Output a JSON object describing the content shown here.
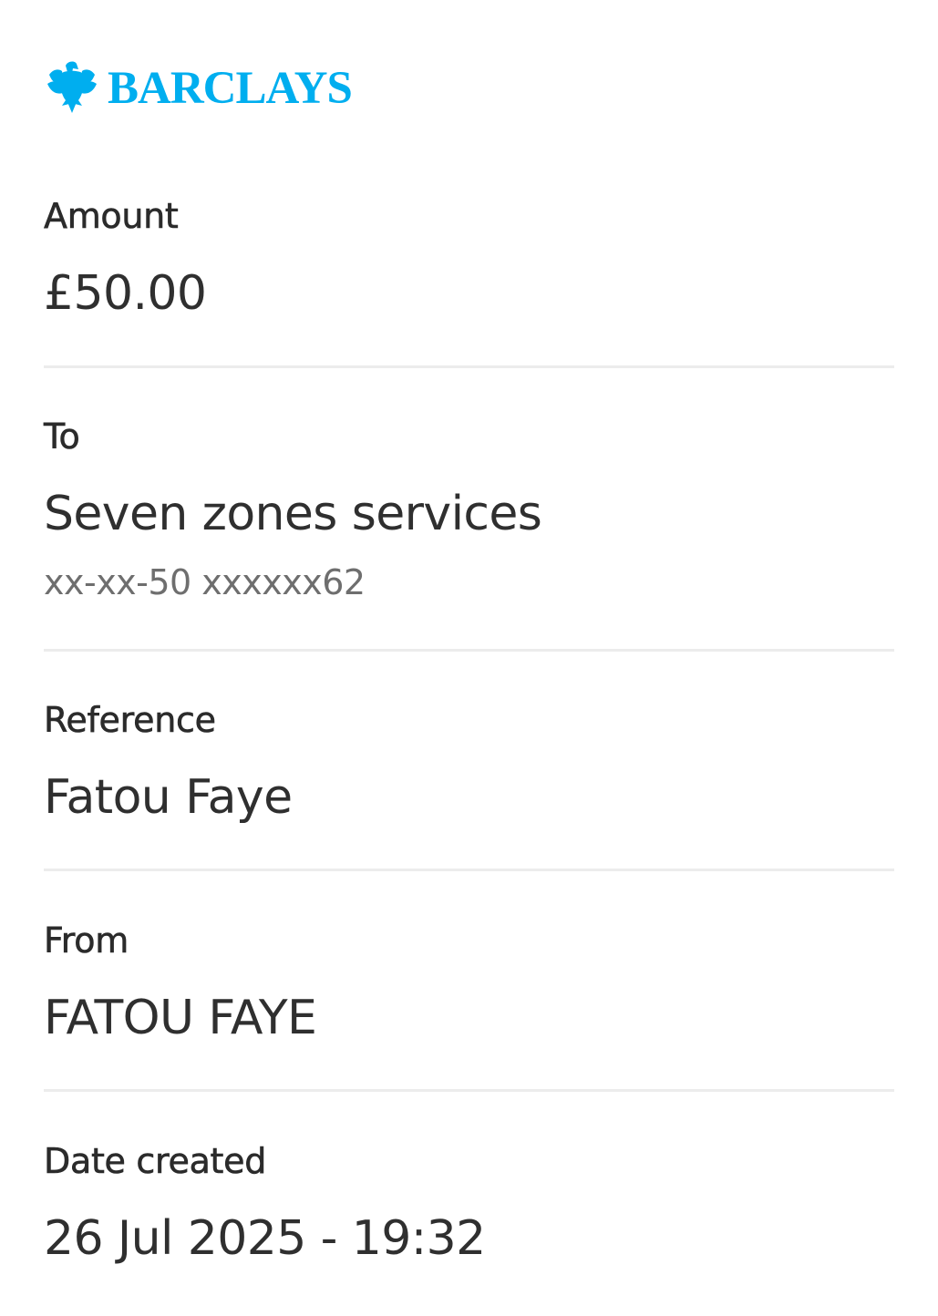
{
  "brand": {
    "name": "BARCLAYS",
    "color": "#00AEEF",
    "icon": "eagle-icon"
  },
  "fields": {
    "amount": {
      "label": "Amount",
      "value": "£50.00"
    },
    "to": {
      "label": "To",
      "value": "Seven zones services",
      "account": "xx-xx-50 xxxxxx62"
    },
    "reference": {
      "label": "Reference",
      "value": "Fatou Faye"
    },
    "from": {
      "label": "From",
      "value": "FATOU FAYE"
    },
    "date_created": {
      "label": "Date created",
      "value": "26 Jul 2025 - 19:32"
    }
  }
}
